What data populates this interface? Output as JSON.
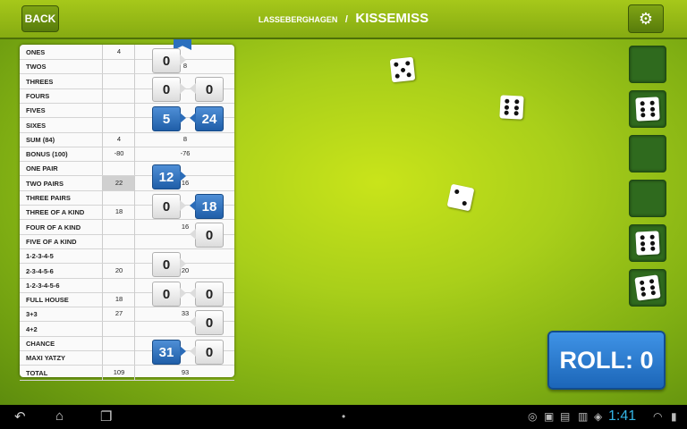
{
  "header": {
    "back_label": "BACK",
    "player_names": "LASSEBERGHAGEN",
    "separator": "/",
    "opponent": "KISSEMISS",
    "settings_icon": "gears-icon"
  },
  "scorecard": {
    "rows": [
      {
        "label": "ONES",
        "p1": "4",
        "p2": ""
      },
      {
        "label": "TWOS",
        "p1": "",
        "p2": "8"
      },
      {
        "label": "THREES",
        "p1": "",
        "p2": ""
      },
      {
        "label": "FOURS",
        "p1": "",
        "p2": ""
      },
      {
        "label": "FIVES",
        "p1": "",
        "p2": ""
      },
      {
        "label": "SIXES",
        "p1": "",
        "p2": ""
      },
      {
        "label": "SUM (84)",
        "p1": "4",
        "p2": "8"
      },
      {
        "label": "BONUS (100)",
        "p1": "-80",
        "p2": "-76"
      },
      {
        "label": "ONE PAIR",
        "p1": "",
        "p2": ""
      },
      {
        "label": "TWO PAIRS",
        "p1": "22",
        "p2": "16"
      },
      {
        "label": "THREE PAIRS",
        "p1": "",
        "p2": ""
      },
      {
        "label": "THREE OF A KIND",
        "p1": "18",
        "p2": ""
      },
      {
        "label": "FOUR OF A KIND",
        "p1": "",
        "p2": "16"
      },
      {
        "label": "FIVE OF A KIND",
        "p1": "",
        "p2": ""
      },
      {
        "label": "1-2-3-4-5",
        "p1": "",
        "p2": ""
      },
      {
        "label": "2-3-4-5-6",
        "p1": "20",
        "p2": "20"
      },
      {
        "label": "1-2-3-4-5-6",
        "p1": "",
        "p2": ""
      },
      {
        "label": "FULL HOUSE",
        "p1": "18",
        "p2": ""
      },
      {
        "label": "3+3",
        "p1": "27",
        "p2": "33"
      },
      {
        "label": "4+2",
        "p1": "",
        "p2": ""
      },
      {
        "label": "CHANCE",
        "p1": "",
        "p2": ""
      },
      {
        "label": "MAXI YATZY",
        "p1": "",
        "p2": ""
      },
      {
        "label": "TOTAL",
        "p1": "109",
        "p2": "93"
      }
    ],
    "markers": [
      {
        "value": "0",
        "style": "white"
      },
      {
        "value": "0",
        "style": "white"
      },
      {
        "value": "0",
        "style": "white"
      },
      {
        "value": "5",
        "style": "blue"
      },
      {
        "value": "24",
        "style": "blue"
      },
      {
        "value": "12",
        "style": "blue"
      },
      {
        "value": "0",
        "style": "white"
      },
      {
        "value": "18",
        "style": "blue"
      },
      {
        "value": "0",
        "style": "white"
      },
      {
        "value": "0",
        "style": "white"
      },
      {
        "value": "0",
        "style": "white"
      },
      {
        "value": "0",
        "style": "white"
      },
      {
        "value": "0",
        "style": "white"
      },
      {
        "value": "31",
        "style": "blue"
      },
      {
        "value": "0",
        "style": "white"
      }
    ]
  },
  "table_dice": [
    5,
    6,
    2
  ],
  "held_slots": [
    null,
    6,
    null,
    null,
    6,
    6
  ],
  "roll_button": {
    "label": "ROLL: 0"
  },
  "status_bar": {
    "time": "1:41",
    "nav": [
      "back-icon",
      "home-icon",
      "recent-apps-icon"
    ]
  },
  "colors": {
    "accent_blue": "#2a6fbe",
    "felt_green": "#a9cf1a"
  }
}
